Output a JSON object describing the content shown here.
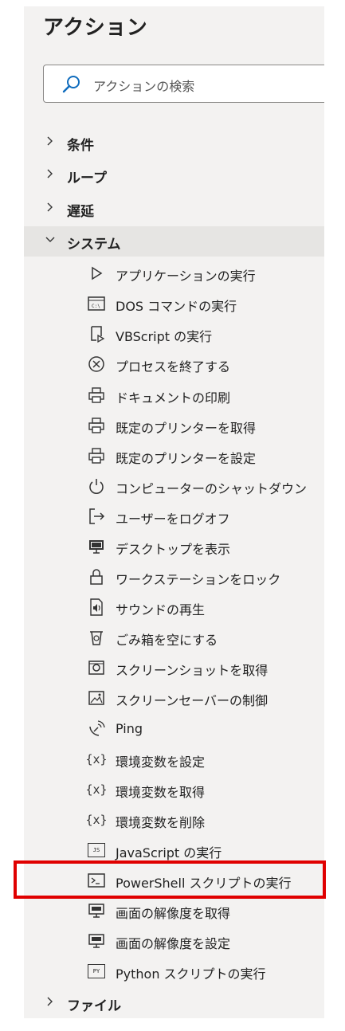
{
  "title": "アクション",
  "search": {
    "placeholder": "アクションの検索"
  },
  "categories_top": [
    {
      "label": "条件"
    },
    {
      "label": "ループ"
    },
    {
      "label": "遅延"
    }
  ],
  "system": {
    "label": "システム",
    "items": [
      {
        "label": "アプリケーションの実行",
        "icon": "play-icon"
      },
      {
        "label": "DOS コマンドの実行",
        "icon": "cmd-window-icon"
      },
      {
        "label": "VBScript の実行",
        "icon": "script-icon"
      },
      {
        "label": "プロセスを終了する",
        "icon": "close-circle-icon"
      },
      {
        "label": "ドキュメントの印刷",
        "icon": "printer-icon"
      },
      {
        "label": "既定のプリンターを取得",
        "icon": "printer-icon"
      },
      {
        "label": "既定のプリンターを設定",
        "icon": "printer-icon"
      },
      {
        "label": "コンピューターのシャットダウン",
        "icon": "power-icon"
      },
      {
        "label": "ユーザーをログオフ",
        "icon": "sign-out-icon"
      },
      {
        "label": "デスクトップを表示",
        "icon": "monitor-icon"
      },
      {
        "label": "ワークステーションをロック",
        "icon": "lock-icon"
      },
      {
        "label": "サウンドの再生",
        "icon": "audio-file-icon"
      },
      {
        "label": "ごみ箱を空にする",
        "icon": "recycle-bin-icon"
      },
      {
        "label": "スクリーンショットを取得",
        "icon": "camera-icon"
      },
      {
        "label": "スクリーンセーバーの制御",
        "icon": "picture-icon"
      },
      {
        "label": "Ping",
        "icon": "satellite-icon"
      },
      {
        "label": "環境変数を設定",
        "icon": "variable-icon",
        "glyph": "{x}"
      },
      {
        "label": "環境変数を取得",
        "icon": "variable-icon",
        "glyph": "{x}"
      },
      {
        "label": "環境変数を削除",
        "icon": "variable-icon",
        "glyph": "{x}"
      },
      {
        "label": "JavaScript の実行",
        "icon": "js-file-icon",
        "glyph": "JS"
      },
      {
        "label": "PowerShell スクリプトの実行",
        "icon": "powershell-icon"
      },
      {
        "label": "画面の解像度を取得",
        "icon": "keyboard-monitor-icon"
      },
      {
        "label": "画面の解像度を設定",
        "icon": "keyboard-monitor-icon"
      },
      {
        "label": "Python スクリプトの実行",
        "icon": "python-file-icon",
        "glyph": "PY"
      }
    ]
  },
  "categories_bottom": [
    {
      "label": "ファイル"
    }
  ],
  "highlight_color": "#e00000"
}
